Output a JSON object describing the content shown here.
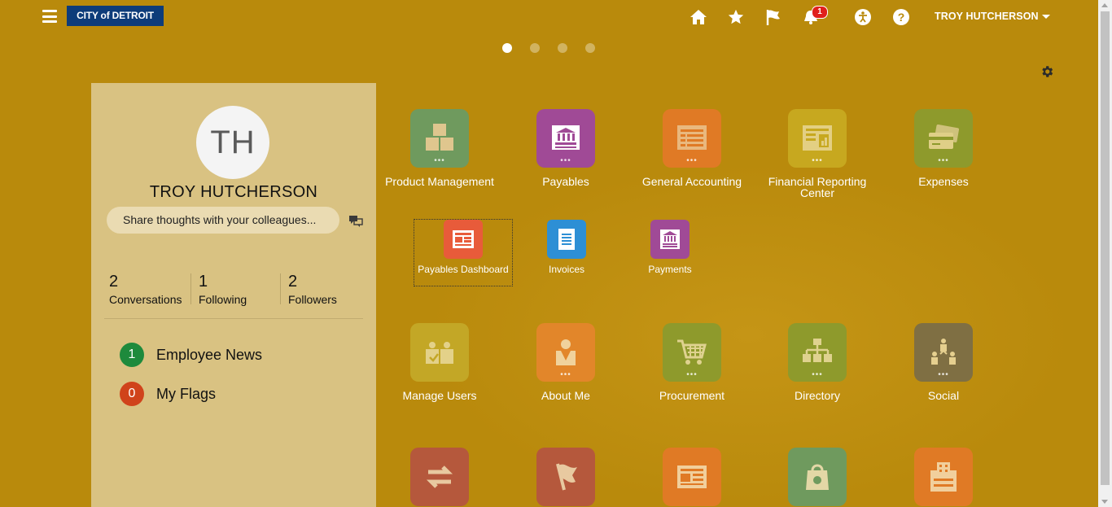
{
  "header": {
    "brand": "CITY of DETROIT",
    "user_name": "TROY HUTCHERSON",
    "notifications_count": "1",
    "icons": [
      "home-icon",
      "star-icon",
      "flag-icon",
      "notifications-icon",
      "accessibility-icon",
      "help-icon"
    ]
  },
  "carousel": {
    "page_count": 4,
    "active_index": 0
  },
  "profile": {
    "initials": "TH",
    "name": "TROY HUTCHERSON",
    "share_placeholder": "Share thoughts with your colleagues...",
    "stats": [
      {
        "num": "2",
        "label": "Conversations"
      },
      {
        "num": "1",
        "label": "Following"
      },
      {
        "num": "2",
        "label": "Followers"
      }
    ],
    "lists": [
      {
        "count": "1",
        "label": "Employee News",
        "color": "#1e8a3c"
      },
      {
        "count": "0",
        "label": "My Flags",
        "color": "#d0431b"
      }
    ]
  },
  "apps_row1": [
    {
      "label": "Product Management",
      "color": "#6f9a5e",
      "icon": "boxes-icon"
    },
    {
      "label": "Payables",
      "color": "#a04a96",
      "icon": "bank-icon"
    },
    {
      "label": "General Accounting",
      "color": "#e07a25",
      "icon": "ledger-icon"
    },
    {
      "label": "Financial Reporting Center",
      "color": "#c7a81f",
      "icon": "report-icon"
    },
    {
      "label": "Expenses",
      "color": "#8e9a2c",
      "icon": "card-icon"
    }
  ],
  "apps_sub": [
    {
      "label": "Payables Dashboard",
      "color": "#e85b3a",
      "icon": "dashboard-icon"
    },
    {
      "label": "Invoices",
      "color": "#2d8fd5",
      "icon": "document-icon"
    },
    {
      "label": "Payments",
      "color": "#a04a96",
      "icon": "bank-icon"
    }
  ],
  "apps_row2": [
    {
      "label": "Manage Users",
      "color": "#c3a726",
      "icon": "users-icon"
    },
    {
      "label": "About Me",
      "color": "#e2862a",
      "icon": "person-icon"
    },
    {
      "label": "Procurement",
      "color": "#8e9a2c",
      "icon": "cart-icon"
    },
    {
      "label": "Directory",
      "color": "#8e9a2c",
      "icon": "org-chart-icon"
    },
    {
      "label": "Social",
      "color": "#7f6f43",
      "icon": "social-icon"
    }
  ],
  "apps_row3": [
    {
      "label": "",
      "color": "#b5583c",
      "icon": "transfer-icon"
    },
    {
      "label": "",
      "color": "#b5583c",
      "icon": "flag-icon"
    },
    {
      "label": "",
      "color": "#e07a25",
      "icon": "news-icon"
    },
    {
      "label": "",
      "color": "#6f9a5e",
      "icon": "bag-icon"
    },
    {
      "label": "",
      "color": "#e07a25",
      "icon": "building-icon"
    }
  ]
}
